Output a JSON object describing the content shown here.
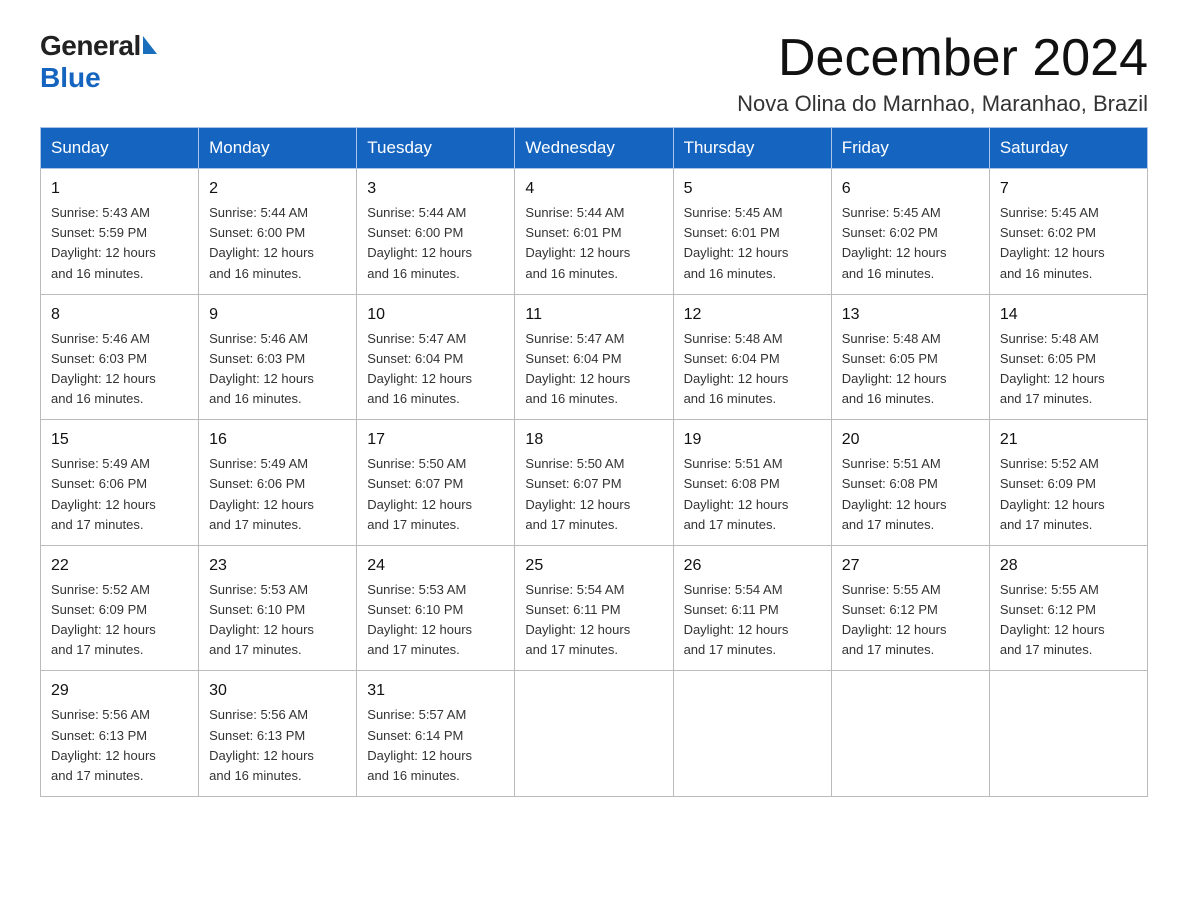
{
  "logo": {
    "general": "General",
    "blue": "Blue"
  },
  "title": {
    "month": "December 2024",
    "location": "Nova Olina do Marnhao, Maranhao, Brazil"
  },
  "headers": [
    "Sunday",
    "Monday",
    "Tuesday",
    "Wednesday",
    "Thursday",
    "Friday",
    "Saturday"
  ],
  "weeks": [
    [
      {
        "day": "1",
        "sunrise": "5:43 AM",
        "sunset": "5:59 PM",
        "daylight": "12 hours and 16 minutes."
      },
      {
        "day": "2",
        "sunrise": "5:44 AM",
        "sunset": "6:00 PM",
        "daylight": "12 hours and 16 minutes."
      },
      {
        "day": "3",
        "sunrise": "5:44 AM",
        "sunset": "6:00 PM",
        "daylight": "12 hours and 16 minutes."
      },
      {
        "day": "4",
        "sunrise": "5:44 AM",
        "sunset": "6:01 PM",
        "daylight": "12 hours and 16 minutes."
      },
      {
        "day": "5",
        "sunrise": "5:45 AM",
        "sunset": "6:01 PM",
        "daylight": "12 hours and 16 minutes."
      },
      {
        "day": "6",
        "sunrise": "5:45 AM",
        "sunset": "6:02 PM",
        "daylight": "12 hours and 16 minutes."
      },
      {
        "day": "7",
        "sunrise": "5:45 AM",
        "sunset": "6:02 PM",
        "daylight": "12 hours and 16 minutes."
      }
    ],
    [
      {
        "day": "8",
        "sunrise": "5:46 AM",
        "sunset": "6:03 PM",
        "daylight": "12 hours and 16 minutes."
      },
      {
        "day": "9",
        "sunrise": "5:46 AM",
        "sunset": "6:03 PM",
        "daylight": "12 hours and 16 minutes."
      },
      {
        "day": "10",
        "sunrise": "5:47 AM",
        "sunset": "6:04 PM",
        "daylight": "12 hours and 16 minutes."
      },
      {
        "day": "11",
        "sunrise": "5:47 AM",
        "sunset": "6:04 PM",
        "daylight": "12 hours and 16 minutes."
      },
      {
        "day": "12",
        "sunrise": "5:48 AM",
        "sunset": "6:04 PM",
        "daylight": "12 hours and 16 minutes."
      },
      {
        "day": "13",
        "sunrise": "5:48 AM",
        "sunset": "6:05 PM",
        "daylight": "12 hours and 16 minutes."
      },
      {
        "day": "14",
        "sunrise": "5:48 AM",
        "sunset": "6:05 PM",
        "daylight": "12 hours and 17 minutes."
      }
    ],
    [
      {
        "day": "15",
        "sunrise": "5:49 AM",
        "sunset": "6:06 PM",
        "daylight": "12 hours and 17 minutes."
      },
      {
        "day": "16",
        "sunrise": "5:49 AM",
        "sunset": "6:06 PM",
        "daylight": "12 hours and 17 minutes."
      },
      {
        "day": "17",
        "sunrise": "5:50 AM",
        "sunset": "6:07 PM",
        "daylight": "12 hours and 17 minutes."
      },
      {
        "day": "18",
        "sunrise": "5:50 AM",
        "sunset": "6:07 PM",
        "daylight": "12 hours and 17 minutes."
      },
      {
        "day": "19",
        "sunrise": "5:51 AM",
        "sunset": "6:08 PM",
        "daylight": "12 hours and 17 minutes."
      },
      {
        "day": "20",
        "sunrise": "5:51 AM",
        "sunset": "6:08 PM",
        "daylight": "12 hours and 17 minutes."
      },
      {
        "day": "21",
        "sunrise": "5:52 AM",
        "sunset": "6:09 PM",
        "daylight": "12 hours and 17 minutes."
      }
    ],
    [
      {
        "day": "22",
        "sunrise": "5:52 AM",
        "sunset": "6:09 PM",
        "daylight": "12 hours and 17 minutes."
      },
      {
        "day": "23",
        "sunrise": "5:53 AM",
        "sunset": "6:10 PM",
        "daylight": "12 hours and 17 minutes."
      },
      {
        "day": "24",
        "sunrise": "5:53 AM",
        "sunset": "6:10 PM",
        "daylight": "12 hours and 17 minutes."
      },
      {
        "day": "25",
        "sunrise": "5:54 AM",
        "sunset": "6:11 PM",
        "daylight": "12 hours and 17 minutes."
      },
      {
        "day": "26",
        "sunrise": "5:54 AM",
        "sunset": "6:11 PM",
        "daylight": "12 hours and 17 minutes."
      },
      {
        "day": "27",
        "sunrise": "5:55 AM",
        "sunset": "6:12 PM",
        "daylight": "12 hours and 17 minutes."
      },
      {
        "day": "28",
        "sunrise": "5:55 AM",
        "sunset": "6:12 PM",
        "daylight": "12 hours and 17 minutes."
      }
    ],
    [
      {
        "day": "29",
        "sunrise": "5:56 AM",
        "sunset": "6:13 PM",
        "daylight": "12 hours and 17 minutes."
      },
      {
        "day": "30",
        "sunrise": "5:56 AM",
        "sunset": "6:13 PM",
        "daylight": "12 hours and 16 minutes."
      },
      {
        "day": "31",
        "sunrise": "5:57 AM",
        "sunset": "6:14 PM",
        "daylight": "12 hours and 16 minutes."
      },
      null,
      null,
      null,
      null
    ]
  ],
  "labels": {
    "sunrise": "Sunrise:",
    "sunset": "Sunset:",
    "daylight": "Daylight:"
  }
}
